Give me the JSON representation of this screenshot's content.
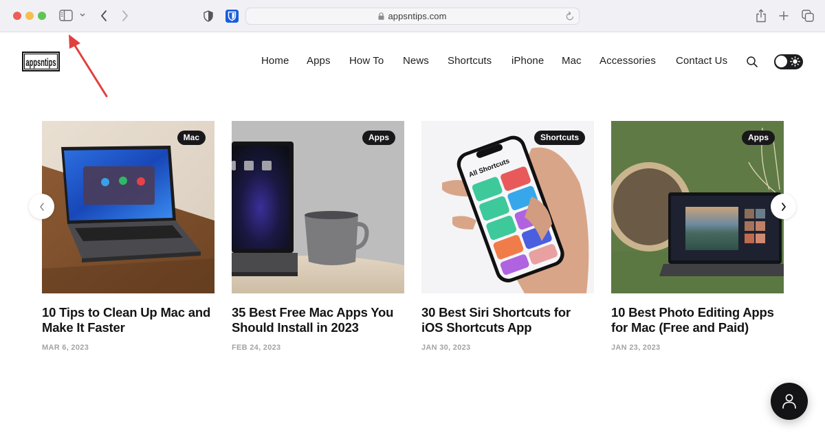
{
  "browser": {
    "url": "appsntips.com",
    "icons": [
      "sidebar-icon",
      "chevron-down-icon",
      "back-icon",
      "forward-icon",
      "privacy-shield-icon",
      "bitwarden-icon",
      "lock-icon",
      "reload-icon",
      "share-icon",
      "new-tab-icon",
      "tab-overview-icon"
    ]
  },
  "site": {
    "logo_text": "appsntips",
    "nav": [
      {
        "label": "Home"
      },
      {
        "label": "Apps"
      },
      {
        "label": "How To"
      },
      {
        "label": "News"
      },
      {
        "label": "Shortcuts"
      },
      {
        "label": "iPhone"
      },
      {
        "label": "Mac"
      },
      {
        "label": "Accessories"
      },
      {
        "label": "Contact Us"
      }
    ],
    "theme_toggle": {
      "state": "light"
    }
  },
  "carousel": {
    "cards": [
      {
        "category": "Mac",
        "title": "10 Tips to Clean Up Mac and Make It Faster",
        "date": "MAR 6, 2023"
      },
      {
        "category": "Apps",
        "title": "35 Best Free Mac Apps You Should Install in 2023",
        "date": "FEB 24, 2023"
      },
      {
        "category": "Shortcuts",
        "title": "30 Best Siri Shortcuts for iOS Shortcuts App",
        "date": "JAN 30, 2023"
      },
      {
        "category": "Apps",
        "title": "10 Best Photo Editing Apps for Mac (Free and Paid)",
        "date": "JAN 23, 2023"
      }
    ]
  },
  "colors": {
    "badge_bg": "#18181a",
    "text_primary": "#141416",
    "date_gray": "#a3a3a6",
    "annotation_arrow": "#e0403f"
  }
}
